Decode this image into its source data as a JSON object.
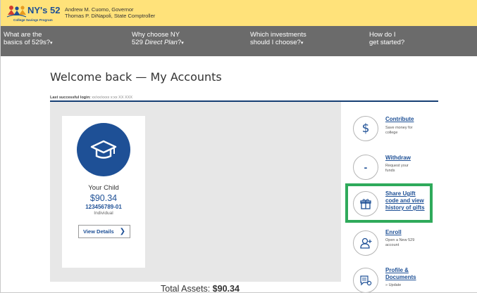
{
  "header": {
    "logo_text": "NY's 529",
    "logo_subtext": "College Savings Program",
    "governor": "Andrew M. Cuomo, Governor",
    "comptroller": "Thomas P. DiNapoli, State Comptroller"
  },
  "nav": {
    "items": [
      {
        "line1": "What are the",
        "line2": "basics of 529s?"
      },
      {
        "line1": "Why choose NY",
        "line2a": "529 ",
        "line2b": "Direct Plan",
        "line2c": "?"
      },
      {
        "line1": "Which investments",
        "line2": "should I choose?"
      },
      {
        "line1": "How do I",
        "line2": "get started?"
      }
    ]
  },
  "page": {
    "title": "Welcome back — My Accounts",
    "last_login_label": "Last successful login:",
    "last_login_value": "xx/xx/xxxx x:xx XX XXX"
  },
  "account": {
    "name": "Your Child",
    "amount": "$90.34",
    "number": "123456789-01",
    "type": "Individual",
    "details_button": "View Details"
  },
  "total": {
    "label": "Total Assets:",
    "value": "$90.34"
  },
  "actions": {
    "contribute": {
      "title": "Contribute",
      "desc1": "Save money for",
      "desc2": "college"
    },
    "withdraw": {
      "title": "Withdraw",
      "desc1": "Request your",
      "desc2": "funds"
    },
    "ugift": {
      "title1": "Share Ugift",
      "title2": "code and view",
      "title3": "history of gifts"
    },
    "enroll": {
      "title": "Enroll",
      "desc1": "Open a New 529",
      "desc2": "account"
    },
    "profile": {
      "title1": "Profile &",
      "title2": "Documents",
      "desc1": "»  Update"
    }
  },
  "colors": {
    "header_yellow": "#ffe27a",
    "nav_grey": "#6b6b6b",
    "brand_blue": "#1e5096",
    "rule_navy": "#163f74",
    "highlight_green": "#2faa5b",
    "panel_grey": "#e7e7e7"
  }
}
